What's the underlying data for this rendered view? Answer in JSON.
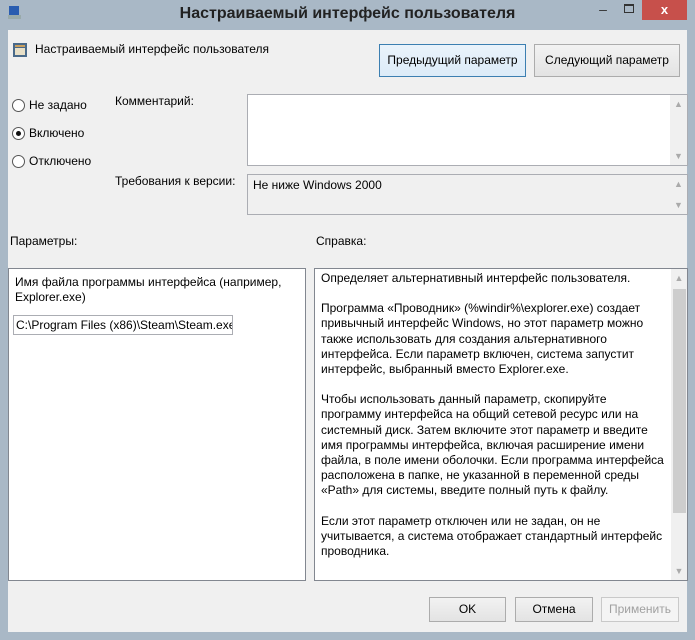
{
  "window": {
    "title": "Настраиваемый интерфейс пользователя",
    "minimize": "–",
    "close": "x"
  },
  "header": {
    "setting_name": "Настраиваемый интерфейс пользователя",
    "prev_button": "Предыдущий параметр",
    "next_button": "Следующий параметр"
  },
  "state": {
    "options": [
      {
        "label": "Не задано",
        "selected": false
      },
      {
        "label": "Включено",
        "selected": true
      },
      {
        "label": "Отключено",
        "selected": false
      }
    ]
  },
  "comment": {
    "label": "Комментарий:",
    "value": ""
  },
  "requirements": {
    "label": "Требования к версии:",
    "value": "Не ниже Windows 2000"
  },
  "options_panel": {
    "label": "Параметры:",
    "field_label": "Имя файла программы интерфейса (например, Explorer.exe)",
    "field_value": "C:\\Program Files (x86)\\Steam\\Steam.exe"
  },
  "help": {
    "label": "Справка:",
    "paragraphs": [
      "Определяет альтернативный интерфейс пользователя.",
      "Программа «Проводник» (%windir%\\explorer.exe) создает привычный интерфейс Windows, но этот параметр можно также использовать для создания альтернативного интерфейса. Если параметр включен, система запустит интерфейс, выбранный вместо Explorer.exe.",
      "Чтобы использовать данный параметр, скопируйте программу интерфейса на общий сетевой ресурс или на системный диск. Затем включите этот параметр и введите имя программы интерфейса, включая расширение имени файла, в поле имени оболочки. Если программа интерфейса расположена в папке, не указанной в переменной среды «Path» для системы, введите полный путь к файлу.",
      "Если этот параметр отключен или не задан, он не учитывается, а система отображает стандартный интерфейс проводника."
    ]
  },
  "footer": {
    "ok": "OK",
    "cancel": "Отмена",
    "apply": "Применить"
  }
}
